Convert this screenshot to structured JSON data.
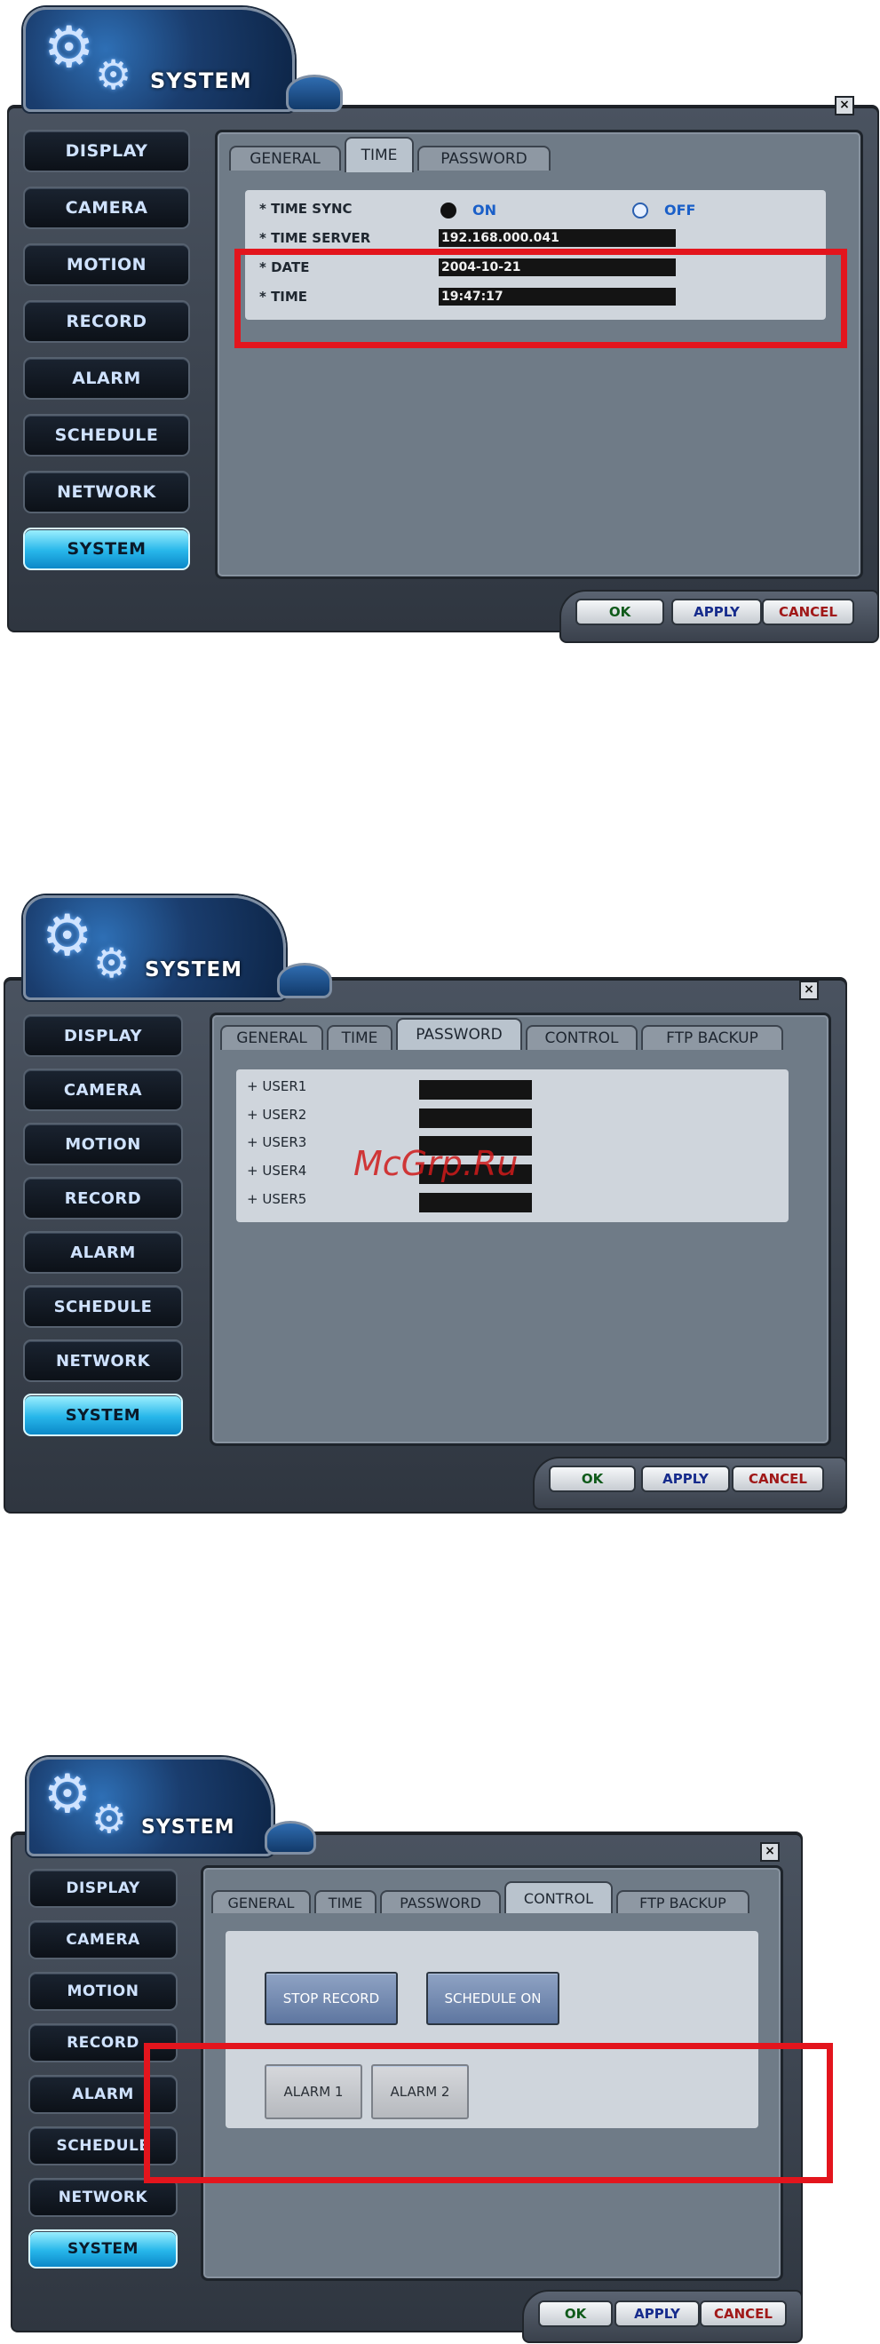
{
  "header": {
    "title": "SYSTEM"
  },
  "sidebar": [
    "DISPLAY",
    "CAMERA",
    "MOTION",
    "RECORD",
    "ALARM",
    "SCHEDULE",
    "NETWORK",
    "SYSTEM"
  ],
  "footer": {
    "ok": "OK",
    "apply": "APPLY",
    "cancel": "CANCEL"
  },
  "close_label": "×",
  "shot1": {
    "tabs": [
      "GENERAL",
      "TIME",
      "PASSWORD"
    ],
    "active_tab": "TIME",
    "time_sync": {
      "label": "* TIME SYNC",
      "on": "ON",
      "off": "OFF"
    },
    "time_server": {
      "label": "* TIME SERVER",
      "value": "192.168.000.041"
    },
    "date": {
      "label": "* DATE",
      "value": "2004-10-21"
    },
    "time": {
      "label": "* TIME",
      "value": "19:47:17"
    }
  },
  "shot2": {
    "tabs": [
      "GENERAL",
      "TIME",
      "PASSWORD",
      "CONTROL",
      "FTP BACKUP"
    ],
    "active_tab": "PASSWORD",
    "users": [
      "+ USER1",
      "+ USER2",
      "+ USER3",
      "+ USER4",
      "+ USER5"
    ]
  },
  "shot3": {
    "tabs": [
      "GENERAL",
      "TIME",
      "PASSWORD",
      "CONTROL",
      "FTP BACKUP"
    ],
    "active_tab": "CONTROL",
    "buttons": {
      "stop_record": "STOP RECORD",
      "schedule_on": "SCHEDULE ON",
      "alarm1": "ALARM 1",
      "alarm2": "ALARM 2"
    }
  },
  "watermark": "McGrp.Ru",
  "colors": {
    "highlight": "#e3151d",
    "active_sidebar": "#27b6ea",
    "panel": "#cfd5dc"
  }
}
